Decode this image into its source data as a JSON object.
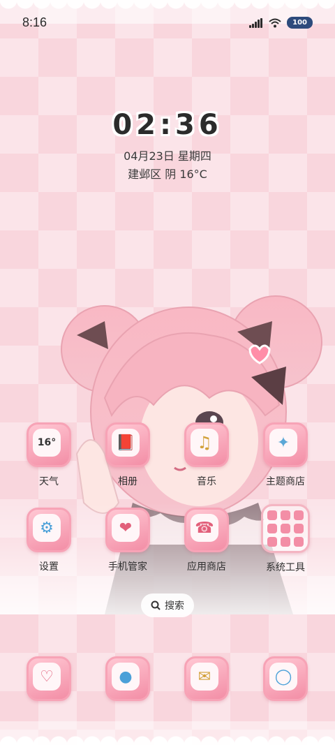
{
  "status_bar": {
    "time": "8:16",
    "battery": "100"
  },
  "clock": {
    "digits": "02:36",
    "date": "04月23日 星期四",
    "weather": "建邺区 阴 16°C"
  },
  "apps_row1": [
    {
      "label": "天气",
      "icon": "weather-icon",
      "badge": "16°"
    },
    {
      "label": "相册",
      "icon": "gallery-icon"
    },
    {
      "label": "音乐",
      "icon": "music-icon"
    },
    {
      "label": "主题商店",
      "icon": "theme-store-icon"
    }
  ],
  "apps_row2": [
    {
      "label": "设置",
      "icon": "settings-icon"
    },
    {
      "label": "手机管家",
      "icon": "phone-manager-icon"
    },
    {
      "label": "应用商店",
      "icon": "app-store-icon"
    },
    {
      "label": "系统工具",
      "icon": "system-tools-folder-icon"
    }
  ],
  "search": {
    "label": "搜索"
  },
  "dock": [
    {
      "icon": "phone-dock-icon"
    },
    {
      "icon": "browser-dock-icon"
    },
    {
      "icon": "messages-dock-icon"
    },
    {
      "icon": "camera-dock-icon"
    }
  ],
  "colors": {
    "accent": "#f38ea6",
    "background": "#f9d6dd",
    "text": "#2f2f2f"
  }
}
